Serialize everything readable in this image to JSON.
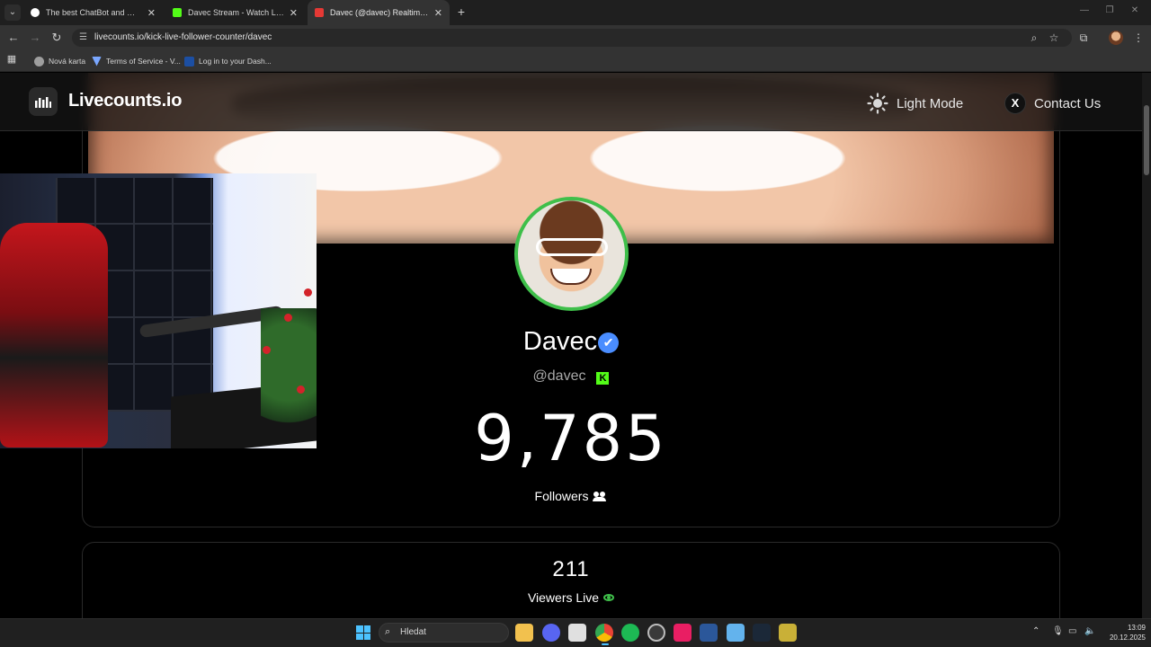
{
  "browser": {
    "tabs": [
      {
        "title": "The best ChatBot and Widgets",
        "active": false
      },
      {
        "title": "Davec Stream - Watch Live on",
        "active": false
      },
      {
        "title": "Davec (@davec) Realtime Kick",
        "active": true
      }
    ],
    "close_glyph": "✕",
    "new_tab_glyph": "+",
    "url": "livecounts.io/kick-live-follower-counter/davec",
    "bookmarks": [
      {
        "label": "Nová karta"
      },
      {
        "label": "Terms of Service - V..."
      },
      {
        "label": "Log in to your Dash..."
      }
    ]
  },
  "header": {
    "logo_text": "Livecounts.io",
    "light_mode_label": "Light Mode",
    "contact_label": "Contact Us",
    "x_glyph": "X"
  },
  "profile": {
    "display_name": "Davec",
    "verified_glyph": "✔",
    "handle": "@davec",
    "platform_glyph": "K",
    "followers_count": "9,785",
    "followers_label": "Followers"
  },
  "viewers": {
    "count": "211",
    "label": "Viewers Live"
  },
  "taskbar": {
    "search_placeholder": "Hledat",
    "time": "13:09",
    "date": "20.12.2025"
  },
  "colors": {
    "accent_green": "#3fbf4a",
    "verified_blue": "#4a8dff",
    "kick_green": "#53fc18",
    "windows_blue": "#4cc2ff"
  }
}
